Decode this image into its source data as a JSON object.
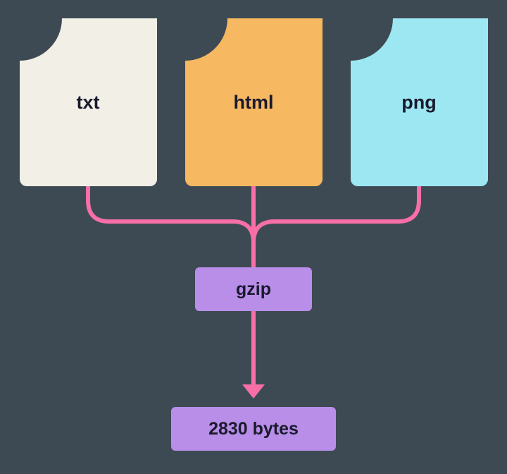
{
  "files": {
    "txt": {
      "label": "txt",
      "color": "#f1efe6"
    },
    "html": {
      "label": "html",
      "color": "#f6b860"
    },
    "png": {
      "label": "png",
      "color": "#9de7f2"
    }
  },
  "process": {
    "label": "gzip"
  },
  "output": {
    "label": "2830 bytes"
  },
  "arrow_color": "#f76fa6"
}
